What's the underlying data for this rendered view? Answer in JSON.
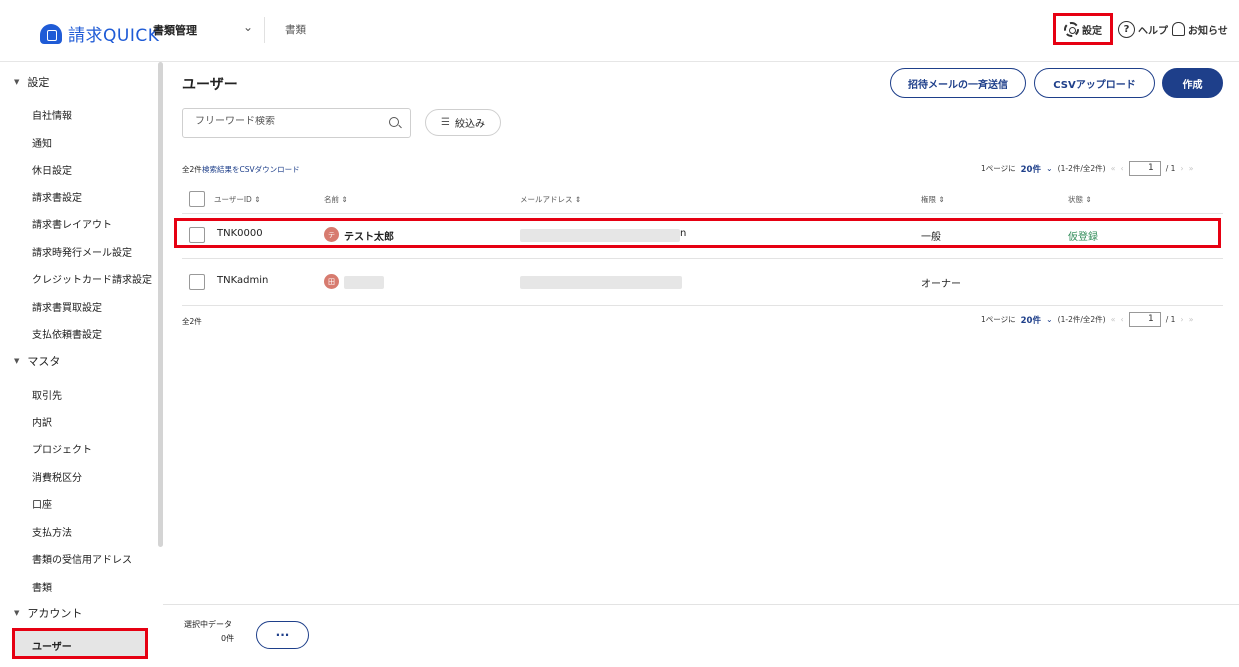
{
  "header": {
    "logo_text": "請求QUICK",
    "menu_main": "書類管理",
    "menu_sub": "書類",
    "settings_label": "設定",
    "help_label": "ヘルプ",
    "help_glyph": "?",
    "notice_label": "お知らせ"
  },
  "sidebar": {
    "sections": [
      {
        "label": "設定",
        "items": [
          "自社情報",
          "通知",
          "休日設定",
          "請求書設定",
          "請求書レイアウト",
          "請求時発行メール設定",
          "クレジットカード請求設定",
          "請求書買取設定",
          "支払依頼書設定"
        ]
      },
      {
        "label": "マスタ",
        "items": [
          "取引先",
          "内訳",
          "プロジェクト",
          "消費税区分",
          "口座",
          "支払方法",
          "書類の受信用アドレス",
          "書類"
        ]
      },
      {
        "label": "アカウント",
        "items": []
      }
    ],
    "active_item": "ユーザー"
  },
  "main": {
    "title": "ユーザー",
    "invite_button": "招待メールの一斉送信",
    "csv_upload_button": "CSVアップロード",
    "create_button": "作成",
    "search_placeholder": "フリーワード検索",
    "filter_button": "絞込み",
    "count_label": "全2件",
    "csv_download_link": "検索結果をCSVダウンロード",
    "pager": {
      "per_page_prefix": "1ページに",
      "per_page": "20件",
      "range": "(1-2件/全2件)",
      "page": "1",
      "total": "/ 1"
    },
    "columns": [
      "ユーザーID",
      "名前",
      "メールアドレス",
      "権限",
      "状態"
    ],
    "rows": [
      {
        "user_id": "TNK0000",
        "avatar": "テ",
        "name": "テスト太郎",
        "email_tail": "n",
        "role": "一般",
        "status": "仮登録"
      },
      {
        "user_id": "TNKadmin",
        "avatar": "田",
        "name": "",
        "email_tail": "",
        "role": "オーナー",
        "status": ""
      }
    ]
  },
  "footer": {
    "selected_label": "選択中データ",
    "selected_count": "0件",
    "more_button": "···"
  },
  "colors": {
    "accent": "#1e3f8a",
    "highlight": "#e60012",
    "status_green": "#2e8b57"
  }
}
